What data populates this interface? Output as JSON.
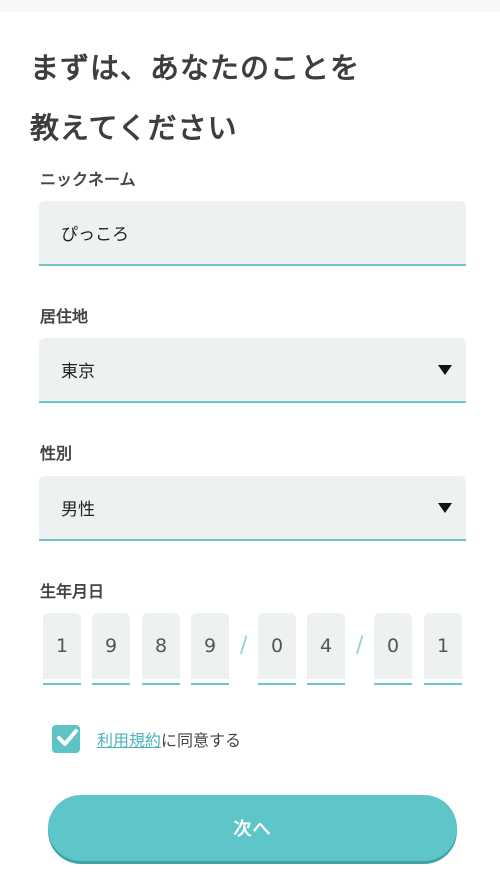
{
  "heading": {
    "line1": "まずは、あなたのことを",
    "line2": "教えてください"
  },
  "nickname": {
    "label": "ニックネーム",
    "value": "ぴっころ"
  },
  "residence": {
    "label": "居住地",
    "value": "東京"
  },
  "gender": {
    "label": "性別",
    "value": "男性"
  },
  "birthdate": {
    "label": "生年月日",
    "digits": [
      "1",
      "9",
      "8",
      "9",
      "0",
      "4",
      "0",
      "1"
    ],
    "separator": "/"
  },
  "agreement": {
    "checked": true,
    "terms_link": "利用規約",
    "text": "に同意する"
  },
  "next_button": {
    "label": "次へ"
  },
  "colors": {
    "accent": "#5ec6c8",
    "field_bg": "#eef1f2",
    "underline": "#6cc5c7",
    "link": "#49b3b6"
  }
}
